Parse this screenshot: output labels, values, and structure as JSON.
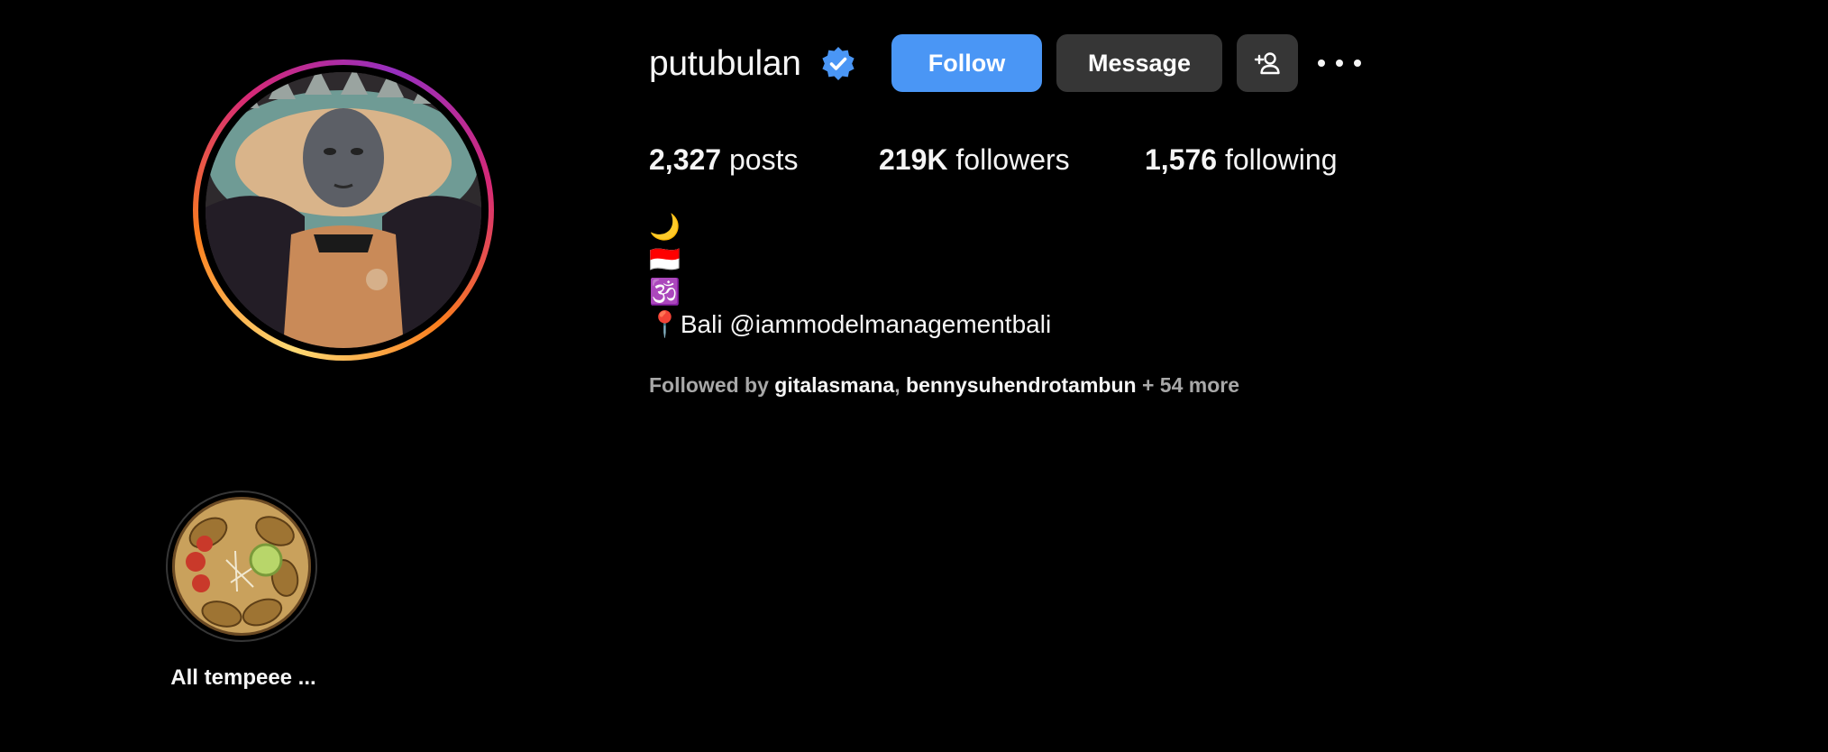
{
  "profile": {
    "username": "putubulan",
    "verified_icon": "verified-badge-icon",
    "accent_color": "#4a96f5"
  },
  "actions": {
    "follow_label": "Follow",
    "message_label": "Message",
    "add_user_icon": "person-add-icon",
    "more_icon": "more-options-icon"
  },
  "stats": {
    "posts_count": "2,327",
    "posts_label": "posts",
    "followers_count": "219K",
    "followers_label": "followers",
    "following_count": "1,576",
    "following_label": "following"
  },
  "bio": {
    "line1": "🌙",
    "line2": "🇮🇩",
    "line3": "🕉️",
    "line4_prefix": "📍Bali ",
    "line4_mention": "@iammodelmanagementbali"
  },
  "followed_by": {
    "prefix": "Followed by ",
    "user1": "gitalasmana",
    "separator": ", ",
    "user2": "bennysuhendrotambun",
    "more": " + 54 more"
  },
  "highlights": [
    {
      "label": "All tempeee ..."
    }
  ]
}
